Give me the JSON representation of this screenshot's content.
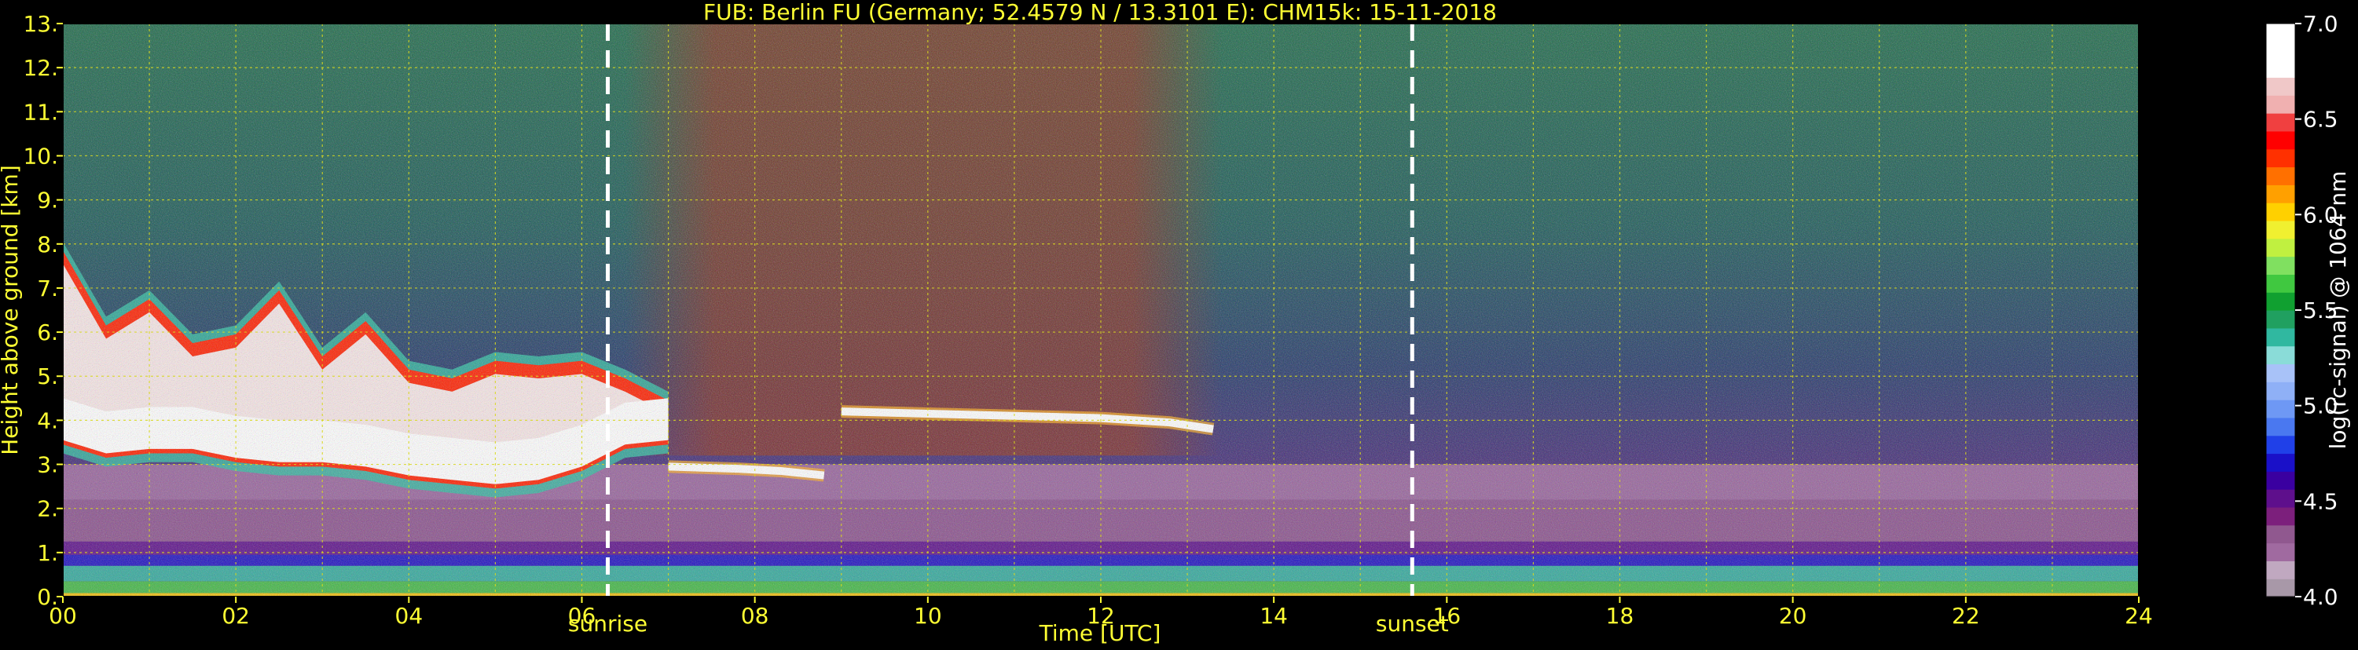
{
  "chart_data": {
    "type": "heatmap",
    "title": "FUB: Berlin FU (Germany; 52.4579 N / 13.3101 E):    CHM15k: 15-11-2018",
    "xlabel": "Time [UTC]",
    "ylabel": "Height above ground [km]",
    "xlim": [
      0,
      24
    ],
    "ylim": [
      0,
      13
    ],
    "x_ticks": [
      "00",
      "02",
      "04",
      "06",
      "08",
      "10",
      "12",
      "14",
      "16",
      "18",
      "20",
      "22",
      "24"
    ],
    "y_ticks": [
      "0.",
      "1.",
      "2.",
      "3.",
      "4.",
      "5.",
      "6.",
      "7.",
      "8.",
      "9.",
      "10.",
      "11.",
      "12.",
      "13."
    ],
    "grid": true,
    "annotations": [
      {
        "label": "sunrise",
        "x": 6.3
      },
      {
        "label": "sunset",
        "x": 15.6
      }
    ],
    "colorbar": {
      "label": "log(rc-signal) @ 1064 nm",
      "range": [
        4.0,
        7.0
      ],
      "ticks": [
        "4.0",
        "4.5",
        "5.0",
        "5.5",
        "6.0",
        "6.5",
        "7.0"
      ],
      "colors": [
        "#a898a8",
        "#c0a8c0",
        "#a06aa0",
        "#90588f",
        "#7c1f7c",
        "#5e0f8c",
        "#3a00a0",
        "#1a10c8",
        "#2040e8",
        "#4a78f0",
        "#6e98f4",
        "#8fb0f6",
        "#a8c2f8",
        "#8adcd8",
        "#30b8a0",
        "#20a060",
        "#10a030",
        "#40c840",
        "#80e060",
        "#c0f040",
        "#f0f030",
        "#ffd000",
        "#ffa000",
        "#ff7000",
        "#ff3000",
        "#ff0000",
        "#f04040",
        "#f0b0b0",
        "#f0c8c8",
        "#ffffff",
        "#ffffff",
        "#ffffff"
      ]
    },
    "layers": [
      {
        "name": "surface",
        "y": [
          0,
          0.08
        ],
        "value": 6.0
      },
      {
        "name": "near-surface",
        "y": [
          0.08,
          0.35
        ],
        "value": 5.6
      },
      {
        "name": "boundary-layer",
        "y": [
          0.35,
          0.7
        ],
        "value": 5.35
      },
      {
        "name": "boundary-top",
        "y": [
          0.7,
          0.95
        ],
        "value": 4.7
      },
      {
        "name": "mixing-blue",
        "y": [
          0.95,
          1.25
        ],
        "value": 4.55
      },
      {
        "name": "aerosol-lower",
        "y": [
          1.25,
          2.2
        ],
        "value": 4.35
      },
      {
        "name": "aerosol-upper",
        "y": [
          2.2,
          3.0
        ],
        "value": 4.2
      }
    ],
    "cloud_tops_km": [
      {
        "t": 0.0,
        "base": 3.4,
        "top": 7.9
      },
      {
        "t": 0.5,
        "base": 3.1,
        "top": 6.2
      },
      {
        "t": 1.0,
        "base": 3.2,
        "top": 6.8
      },
      {
        "t": 1.5,
        "base": 3.2,
        "top": 5.8
      },
      {
        "t": 2.0,
        "base": 3.0,
        "top": 6.0
      },
      {
        "t": 2.5,
        "base": 2.9,
        "top": 7.0
      },
      {
        "t": 3.0,
        "base": 2.9,
        "top": 5.5
      },
      {
        "t": 3.5,
        "base": 2.8,
        "top": 6.3
      },
      {
        "t": 4.0,
        "base": 2.6,
        "top": 5.2
      },
      {
        "t": 4.5,
        "base": 2.5,
        "top": 5.0
      },
      {
        "t": 5.0,
        "base": 2.4,
        "top": 5.4
      },
      {
        "t": 5.5,
        "base": 2.5,
        "top": 5.3
      },
      {
        "t": 6.0,
        "base": 2.8,
        "top": 5.4
      },
      {
        "t": 6.5,
        "base": 3.3,
        "top": 5.0
      },
      {
        "t": 7.0,
        "base": 3.4,
        "top": 4.5
      }
    ],
    "thin_cloud_km": [
      {
        "t": 7.0,
        "y": 2.95
      },
      {
        "t": 7.8,
        "y": 2.9
      },
      {
        "t": 8.3,
        "y": 2.85
      },
      {
        "t": 8.8,
        "y": 2.75
      },
      {
        "t": 9.0,
        "y": 4.2
      },
      {
        "t": 10.0,
        "y": 4.15
      },
      {
        "t": 11.0,
        "y": 4.1
      },
      {
        "t": 12.0,
        "y": 4.05
      },
      {
        "t": 12.8,
        "y": 3.95
      },
      {
        "t": 13.3,
        "y": 3.8
      }
    ]
  }
}
